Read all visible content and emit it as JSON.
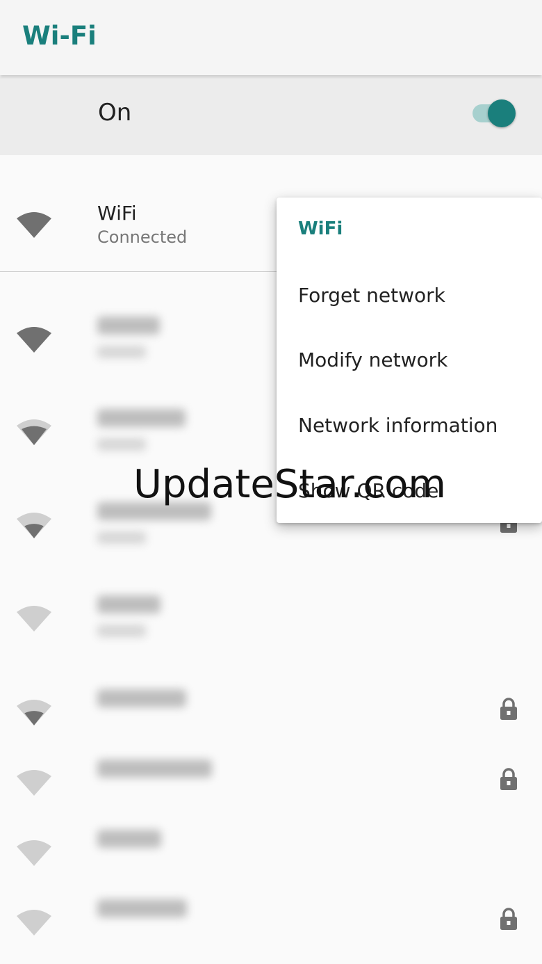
{
  "app_bar": {
    "title": "Wi-Fi"
  },
  "master_toggle": {
    "label": "On",
    "checked": true
  },
  "connected_network": {
    "name": "WiFi",
    "status": "Connected",
    "signal": 4
  },
  "networks": [
    {
      "signal": 4,
      "locked": false
    },
    {
      "signal": 3,
      "locked": false
    },
    {
      "signal": 2,
      "locked": true
    },
    {
      "signal": 1,
      "locked": false
    },
    {
      "signal": 2,
      "locked": true
    },
    {
      "signal": 1,
      "locked": true
    },
    {
      "signal": 1,
      "locked": false
    },
    {
      "signal": 1,
      "locked": true
    }
  ],
  "context_menu": {
    "title": "WiFi",
    "items": [
      "Forget network",
      "Modify network",
      "Network information",
      "Show QR code"
    ]
  },
  "watermark": "UpdateStar.com",
  "colors": {
    "accent": "#1a7f7c",
    "icon_dark": "#707070",
    "icon_light": "#cfcfcf"
  }
}
